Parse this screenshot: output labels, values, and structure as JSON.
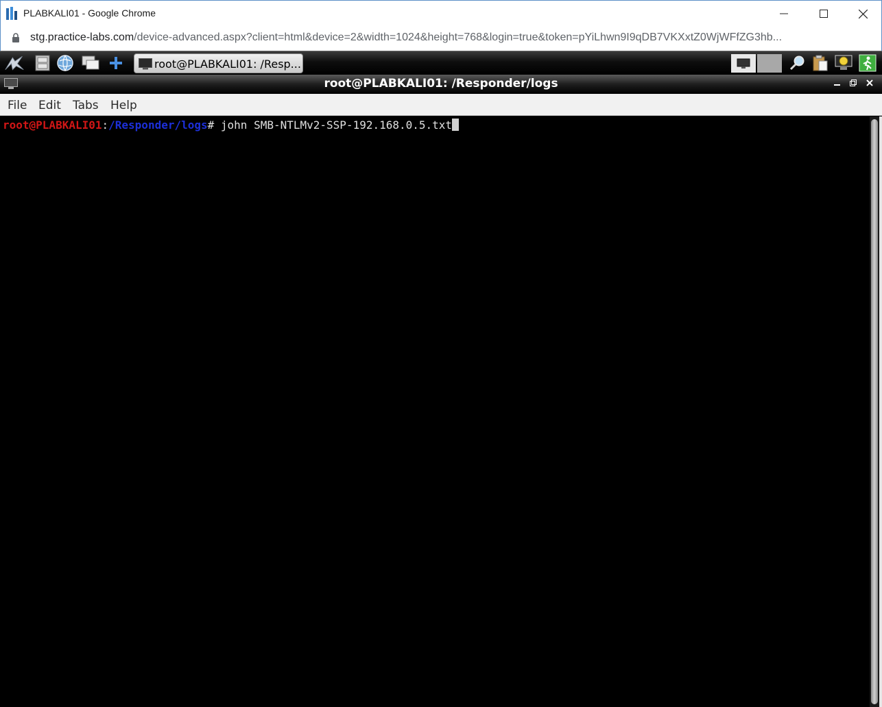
{
  "browser": {
    "window_title": "PLABKALI01 - Google Chrome",
    "url_host": "stg.practice-labs.com",
    "url_rest": "/device-advanced.aspx?client=html&device=2&width=1024&height=768&login=true&token=pYiLhwn9I9qDB7VKXxtZ0WjWFfZG3hb..."
  },
  "panel": {
    "task_label": "root@PLABKALI01: /Resp..."
  },
  "terminal_window": {
    "title": "root@PLABKALI01: /Responder/logs",
    "menu": [
      "File",
      "Edit",
      "Tabs",
      "Help"
    ]
  },
  "terminal": {
    "prompt_user": "root@PLABKALI01",
    "prompt_sep": ":",
    "prompt_path": "/Responder/logs",
    "prompt_symbol": "# ",
    "command": "john SMB-NTLMv2-SSP-192.168.0.5.txt"
  },
  "colors": {
    "prompt_user": "#d11616",
    "prompt_path": "#1c2fd8",
    "terminal_bg": "#000000"
  }
}
